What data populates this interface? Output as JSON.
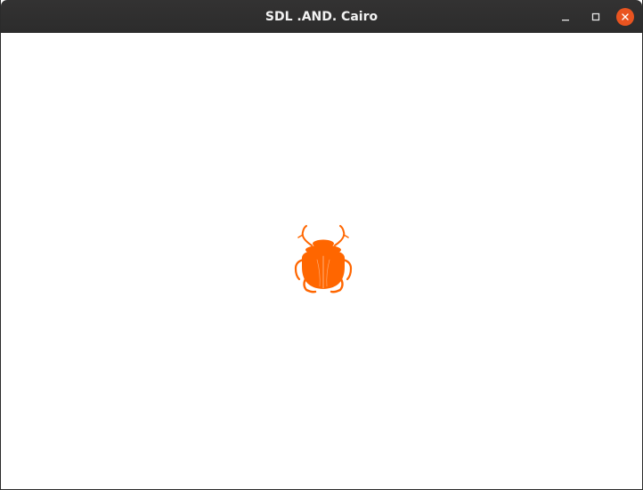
{
  "window": {
    "title": "SDL .AND. Cairo"
  },
  "controls": {
    "minimize_icon": "minimize-icon",
    "maximize_icon": "maximize-icon",
    "close_icon": "close-icon"
  },
  "canvas": {
    "image": "scarab-beetle-icon",
    "color": "#ff6600"
  }
}
